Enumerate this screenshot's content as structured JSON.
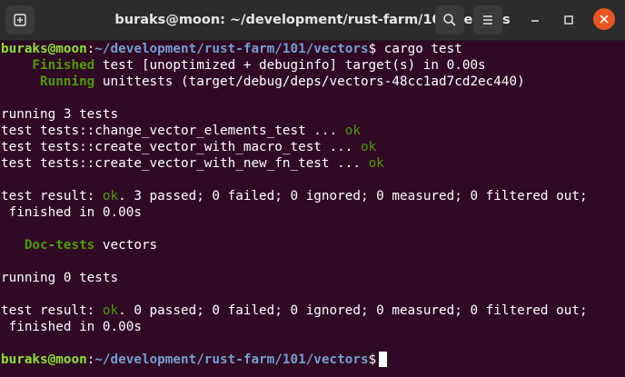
{
  "window": {
    "title": "buraks@moon: ~/development/rust-farm/101/vectors",
    "new_tab_icon": "new-tab-icon",
    "search_icon": "search-icon",
    "menu_icon": "hamburger-menu-icon",
    "minimize_icon": "minimize-icon",
    "maximize_icon": "maximize-icon",
    "close_icon": "close-icon",
    "close_color": "#e95420",
    "background": "#300a24"
  },
  "terminal": {
    "prompt_user": "buraks@moon",
    "prompt_sep": ":",
    "prompt_path": "~/development/rust-farm/101/vectors",
    "prompt_dollar": "$ ",
    "command": "cargo test",
    "finished_label": "    Finished",
    "finished_text": " test [unoptimized + debuginfo] target(s) in 0.00s",
    "running_label": "     Running",
    "running_text": " unittests (target/debug/deps/vectors-48cc1ad7cd2ec440)",
    "running_tests_1": "running 3 tests",
    "tests": [
      {
        "name": "test tests::change_vector_elements_test ... ",
        "status": "ok"
      },
      {
        "name": "test tests::create_vector_with_macro_test ... ",
        "status": "ok"
      },
      {
        "name": "test tests::create_vector_with_new_fn_test ... ",
        "status": "ok"
      }
    ],
    "result1_prefix": "test result: ",
    "result1_ok": "ok",
    "result1_rest": ". 3 passed; 0 failed; 0 ignored; 0 measured; 0 filtered out;",
    "result1_time": " finished in 0.00s",
    "doctests_label": "   Doc-tests",
    "doctests_text": " vectors",
    "running_tests_2": "running 0 tests",
    "result2_prefix": "test result: ",
    "result2_ok": "ok",
    "result2_rest": ". 0 passed; 0 failed; 0 ignored; 0 measured; 0 filtered out;",
    "result2_time": " finished in 0.00s",
    "final_prompt_dollar": "$"
  }
}
